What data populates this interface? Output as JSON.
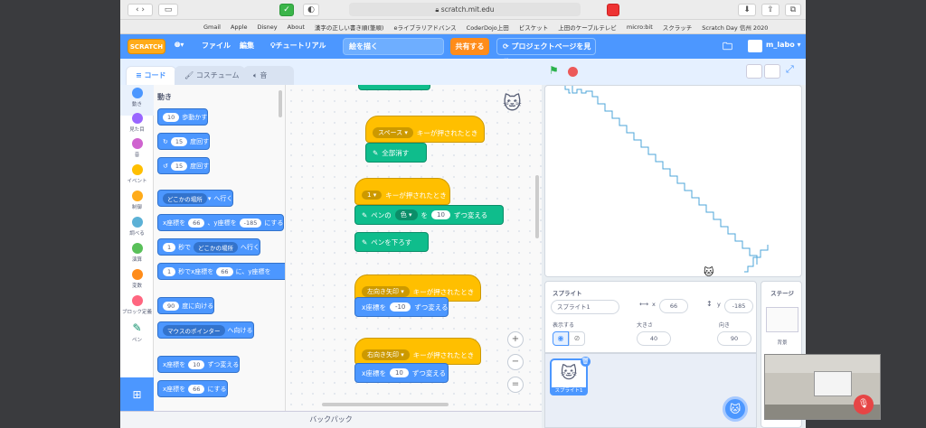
{
  "browser": {
    "url": "scratch.mit.edu",
    "bookmarks": [
      "Gmail",
      "Apple",
      "Disney",
      "About",
      "漢字の正しい書き順(筆順)",
      "eライブラリアドバンス",
      "CoderDojo上田",
      "ビスケット",
      "上田のケーブルテレビ",
      "micro:bit",
      "スクラッチ",
      "Scratch Day 信州 2020"
    ]
  },
  "menu": {
    "logo": "SCRATCH",
    "file": "ファイル",
    "edit": "編集",
    "tutorial": "チュートリアル",
    "project_title": "絵を描く",
    "share": "共有する",
    "project_page": "プロジェクトページを見る",
    "user": "m_labo"
  },
  "tabs": {
    "code": "コード",
    "costume": "コスチューム",
    "sound": "音"
  },
  "categories": [
    {
      "label": "動き",
      "color": "#4c97ff"
    },
    {
      "label": "見た目",
      "color": "#9966ff"
    },
    {
      "label": "音",
      "color": "#cf63cf"
    },
    {
      "label": "イベント",
      "color": "#ffbf00"
    },
    {
      "label": "制御",
      "color": "#ffab19"
    },
    {
      "label": "調べる",
      "color": "#5cb1d6"
    },
    {
      "label": "演算",
      "color": "#59c059"
    },
    {
      "label": "変数",
      "color": "#ff8c1a"
    },
    {
      "label": "ブロック定義",
      "color": "#ff6680"
    },
    {
      "label": "ペン",
      "color": "#0fbd8c"
    }
  ],
  "palette": {
    "heading": "動き",
    "b1": {
      "v": "10",
      "t": "歩動かす"
    },
    "b2": {
      "v": "15",
      "t": "度回す"
    },
    "b3": {
      "v": "15",
      "t": "度回す"
    },
    "b4": {
      "dd": "どこかの場所",
      "t": "へ行く"
    },
    "b5": {
      "a": "x座標を",
      "x": "66",
      "m": "、y座標を",
      "y": "-185",
      "t": "にする"
    },
    "b6": {
      "v": "1",
      "m": "秒で",
      "dd": "どこかの場所",
      "t": "へ行く"
    },
    "b7": {
      "v": "1",
      "m": "秒でx座標を",
      "x": "66",
      "t": "に、y座標を"
    },
    "b8": {
      "v": "90",
      "t": "度に向ける"
    },
    "b9": {
      "dd": "マウスのポインター",
      "t": "へ向ける"
    },
    "b10": {
      "a": "x座標を",
      "v": "10",
      "t": "ずつ変える"
    },
    "b11": {
      "a": "x座標を",
      "v": "66",
      "t": "にする"
    }
  },
  "script": {
    "s1": {
      "key": "スペース",
      "t": "キーが押されたとき",
      "a": "全部消す"
    },
    "s2": {
      "key": "1",
      "t": "キーが押されたとき",
      "pen": "ペンの",
      "prop": "色",
      "o": "を",
      "v": "10",
      "e": "ずつ変える",
      "down": "ペンを下ろす"
    },
    "s3": {
      "key": "左向き矢印",
      "t": "キーが押されたとき",
      "a": "x座標を",
      "v": "-10",
      "e": "ずつ変える"
    },
    "s4": {
      "key": "右向き矢印",
      "t": "キーが押されたとき",
      "a": "x座標を",
      "v": "10",
      "e": "ずつ変える"
    }
  },
  "zoom": {
    "in": "+",
    "out": "−",
    "reset": "="
  },
  "backpack": "バックパック",
  "sprite": {
    "heading": "スプライト",
    "name": "スプライト1",
    "x_label": "x",
    "x": "66",
    "y_label": "y",
    "y": "-185",
    "show": "表示する",
    "size_label": "大きさ",
    "size": "40",
    "dir_label": "向き",
    "dir": "90",
    "thumb": "スプライト1"
  },
  "stage": {
    "heading": "ステージ",
    "backdrop": "背景"
  }
}
